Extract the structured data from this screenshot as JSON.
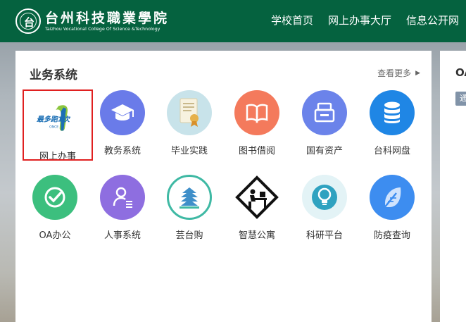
{
  "header": {
    "logo_cn": "台州科技職業學院",
    "logo_en": "Taizhou Vocational College Of Science &Technology",
    "nav": [
      "学校首页",
      "网上办事大厅",
      "信息公开网"
    ]
  },
  "business": {
    "title": "业务系统",
    "more": "查看更多",
    "apps": [
      {
        "name": "网上办事",
        "icon": "zui-duo-pao-yi-ci-logo",
        "icon_text": "最多跑1次"
      },
      {
        "name": "教务系统",
        "icon": "graduation-cap-icon"
      },
      {
        "name": "毕业实践",
        "icon": "certificate-icon"
      },
      {
        "name": "图书借阅",
        "icon": "open-book-icon"
      },
      {
        "name": "国有资产",
        "icon": "printer-icon"
      },
      {
        "name": "台科网盘",
        "icon": "database-icon"
      },
      {
        "name": "OA办公",
        "icon": "check-circle-icon"
      },
      {
        "name": "人事系统",
        "icon": "user-list-icon"
      },
      {
        "name": "芸台购",
        "icon": "building-icon"
      },
      {
        "name": "智慧公寓",
        "icon": "desk-person-icon"
      },
      {
        "name": "科研平台",
        "icon": "lightbulb-icon"
      },
      {
        "name": "防疫查询",
        "icon": "feather-icon"
      }
    ]
  },
  "side": {
    "title": "OA",
    "tag": "通"
  },
  "colors": {
    "header_bg": "#05623f",
    "selected_border": "#e02020"
  }
}
